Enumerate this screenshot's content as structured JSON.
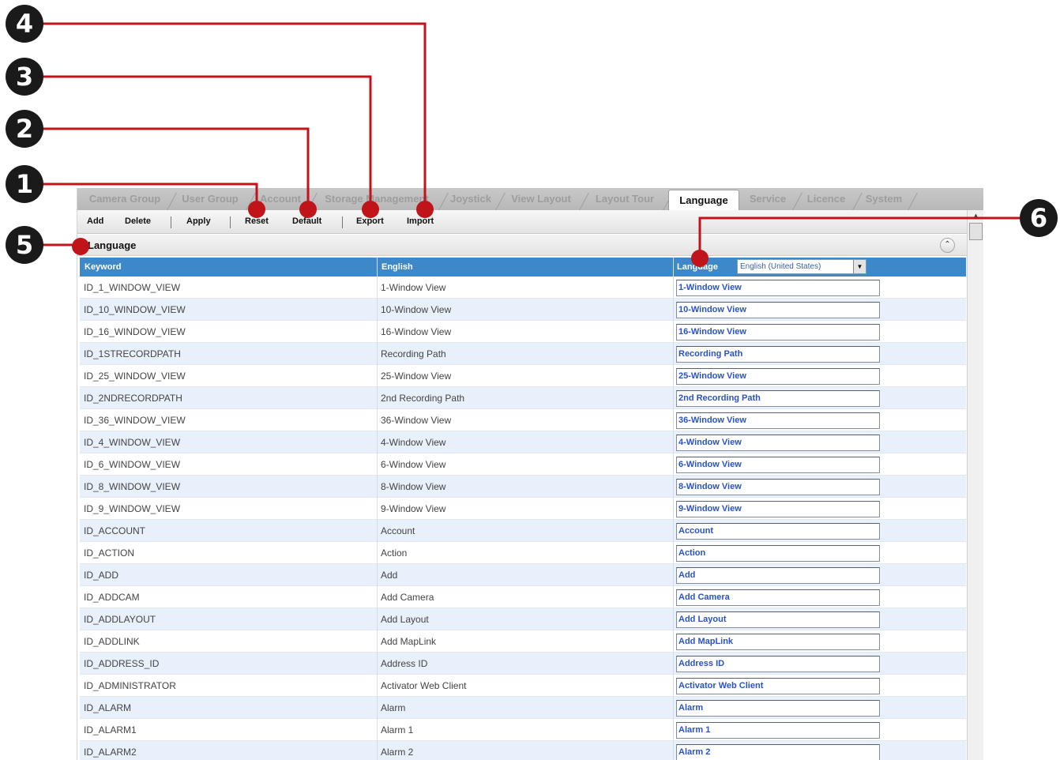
{
  "tabs": [
    {
      "label": "Camera Group",
      "active": false
    },
    {
      "label": "User Group",
      "active": false
    },
    {
      "label": "Account",
      "active": false
    },
    {
      "label": "Storage Management",
      "active": false
    },
    {
      "label": "Joystick",
      "active": false
    },
    {
      "label": "View Layout",
      "active": false
    },
    {
      "label": "Layout Tour",
      "active": false
    },
    {
      "label": "Language",
      "active": true
    },
    {
      "label": "Service",
      "active": false
    },
    {
      "label": "Licence",
      "active": false
    },
    {
      "label": "System",
      "active": false
    }
  ],
  "toolbar": {
    "add_label": "Add",
    "delete_label": "Delete",
    "apply_label": "Apply",
    "reset_label": "Reset",
    "default_label": "Default",
    "export_label": "Export",
    "import_label": "Import"
  },
  "section": {
    "title": "Language",
    "collapse_icon": "chevron-double-up-icon"
  },
  "grid": {
    "headers": {
      "keyword": "Keyword",
      "english": "English",
      "language": "Language"
    },
    "language_select": {
      "selected": "English (United States)"
    },
    "rows": [
      {
        "keyword": "ID_1_WINDOW_VIEW",
        "english": "1-Window View",
        "translation": "1-Window View"
      },
      {
        "keyword": "ID_10_WINDOW_VIEW",
        "english": "10-Window View",
        "translation": "10-Window View"
      },
      {
        "keyword": "ID_16_WINDOW_VIEW",
        "english": "16-Window View",
        "translation": "16-Window View"
      },
      {
        "keyword": "ID_1STRECORDPATH",
        "english": "Recording Path",
        "translation": "Recording Path"
      },
      {
        "keyword": "ID_25_WINDOW_VIEW",
        "english": "25-Window View",
        "translation": "25-Window View"
      },
      {
        "keyword": "ID_2NDRECORDPATH",
        "english": "2nd Recording Path",
        "translation": "2nd Recording Path"
      },
      {
        "keyword": "ID_36_WINDOW_VIEW",
        "english": "36-Window View",
        "translation": "36-Window View"
      },
      {
        "keyword": "ID_4_WINDOW_VIEW",
        "english": "4-Window View",
        "translation": "4-Window View"
      },
      {
        "keyword": "ID_6_WINDOW_VIEW",
        "english": "6-Window View",
        "translation": "6-Window View"
      },
      {
        "keyword": "ID_8_WINDOW_VIEW",
        "english": "8-Window View",
        "translation": "8-Window View"
      },
      {
        "keyword": "ID_9_WINDOW_VIEW",
        "english": "9-Window View",
        "translation": "9-Window View"
      },
      {
        "keyword": "ID_ACCOUNT",
        "english": "Account",
        "translation": "Account"
      },
      {
        "keyword": "ID_ACTION",
        "english": "Action",
        "translation": "Action"
      },
      {
        "keyword": "ID_ADD",
        "english": "Add",
        "translation": "Add"
      },
      {
        "keyword": "ID_ADDCAM",
        "english": "Add Camera",
        "translation": "Add Camera"
      },
      {
        "keyword": "ID_ADDLAYOUT",
        "english": "Add Layout",
        "translation": "Add Layout"
      },
      {
        "keyword": "ID_ADDLINK",
        "english": "Add MapLink",
        "translation": "Add MapLink"
      },
      {
        "keyword": "ID_ADDRESS_ID",
        "english": "Address ID",
        "translation": "Address ID"
      },
      {
        "keyword": "ID_ADMINISTRATOR",
        "english": "Activator Web Client",
        "translation": "Activator Web Client"
      },
      {
        "keyword": "ID_ALARM",
        "english": "Alarm",
        "translation": "Alarm"
      },
      {
        "keyword": "ID_ALARM1",
        "english": "Alarm 1",
        "translation": "Alarm 1"
      },
      {
        "keyword": "ID_ALARM2",
        "english": "Alarm 2",
        "translation": "Alarm 2"
      }
    ]
  },
  "callouts": [
    {
      "label": "1",
      "target": "Reset"
    },
    {
      "label": "2",
      "target": "Default"
    },
    {
      "label": "3",
      "target": "Export"
    },
    {
      "label": "4",
      "target": "Import"
    },
    {
      "label": "5",
      "target": "Language panel"
    },
    {
      "label": "6",
      "target": "Language selector"
    }
  ],
  "colors": {
    "header_blue": "#3c88c8",
    "callout": "#1a1a1a",
    "leader_line": "#c0141a",
    "translation_text": "#2a52c8"
  }
}
